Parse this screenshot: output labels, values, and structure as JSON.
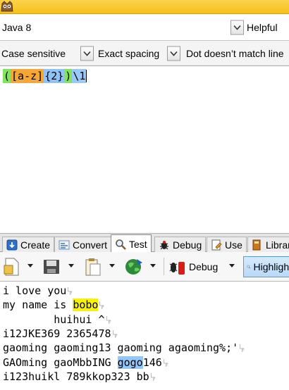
{
  "top": {
    "icon": "app-owl-icon"
  },
  "row1": {
    "flavor": "Java 8",
    "help": "Helpful"
  },
  "row2": {
    "case": "Case sensitive",
    "spacing": "Exact spacing",
    "dot": "Dot doesn’t match line"
  },
  "regex": {
    "tokens": [
      {
        "text": "(",
        "cls": "t-green"
      },
      {
        "text": "[a-z]",
        "cls": "t-orange"
      },
      {
        "text": "{2}",
        "cls": "t-blue"
      },
      {
        "text": ")",
        "cls": "t-green"
      },
      {
        "text": "\\1",
        "cls": "t-sel"
      }
    ]
  },
  "tabs": [
    {
      "label": "Create",
      "icon": "create-icon"
    },
    {
      "label": "Convert",
      "icon": "convert-icon"
    },
    {
      "label": "Test",
      "icon": "magnifier-icon",
      "active": true
    },
    {
      "label": "Debug",
      "icon": "bug-icon"
    },
    {
      "label": "Use",
      "icon": "use-icon"
    },
    {
      "label": "Library",
      "icon": "library-icon"
    }
  ],
  "toolbar": {
    "debug_label": "Debug",
    "highlight_label": "Highlight"
  },
  "test_lines": [
    [
      {
        "t": "i love you"
      }
    ],
    [
      {
        "t": "my name is "
      },
      {
        "t": "bobo",
        "m": "m-yellow"
      }
    ],
    [
      {
        "t": "        huihui ^"
      }
    ],
    [
      {
        "t": "i12JKE369 2365478"
      }
    ],
    [
      {
        "t": "gaoming gaoming13 gaoming agaoming%;'"
      }
    ],
    [
      {
        "t": "GAOming gaoMbbING "
      },
      {
        "t": "gogo",
        "m": "m-blue"
      },
      {
        "t": "146"
      }
    ],
    [
      {
        "t": "i123huikl 789kkop323 bb"
      }
    ]
  ]
}
